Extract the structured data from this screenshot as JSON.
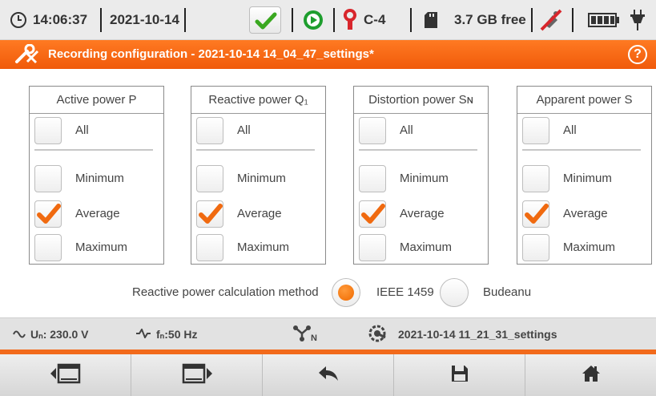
{
  "status_bar": {
    "time": "14:06:37",
    "date": "2021-10-14",
    "clamp_label": "C-4",
    "storage_free": "3.7 GB free",
    "icons": [
      "clock-icon",
      "checkmark-icon",
      "record-play-icon",
      "clamp-icon",
      "sd-card-icon",
      "no-gps-icon",
      "battery-icon",
      "power-plug-icon"
    ],
    "colors": {
      "check_green": "#3aa820",
      "play_green": "#1e9e2e",
      "clamp_red": "#d8262c",
      "bar_bg": "#ebebeb"
    }
  },
  "title_bar": {
    "title": "Recording configuration - 2021-10-14 14_04_47_settings*",
    "help_label": "?",
    "color": "#f26a1b"
  },
  "panels": [
    {
      "title": "Active power P",
      "all_label": "All",
      "options": [
        {
          "label": "Minimum",
          "checked": false
        },
        {
          "label": "Average",
          "checked": true
        },
        {
          "label": "Maximum",
          "checked": false
        }
      ]
    },
    {
      "title": "Reactive power Q₁",
      "all_label": "All",
      "options": [
        {
          "label": "Minimum",
          "checked": false
        },
        {
          "label": "Average",
          "checked": true
        },
        {
          "label": "Maximum",
          "checked": false
        }
      ]
    },
    {
      "title": "Distortion power Sɴ",
      "all_label": "All",
      "options": [
        {
          "label": "Minimum",
          "checked": false
        },
        {
          "label": "Average",
          "checked": true
        },
        {
          "label": "Maximum",
          "checked": false
        }
      ]
    },
    {
      "title": "Apparent power S",
      "all_label": "All",
      "options": [
        {
          "label": "Minimum",
          "checked": false
        },
        {
          "label": "Average",
          "checked": true
        },
        {
          "label": "Maximum",
          "checked": false
        }
      ]
    }
  ],
  "method": {
    "label": "Reactive power calculation method",
    "options": [
      {
        "label": "IEEE 1459",
        "selected": true
      },
      {
        "label": "Budeanu",
        "selected": false
      }
    ]
  },
  "info_bar": {
    "voltage": "Uₙ: 230.0 V",
    "frequency": "fₙ:50 Hz",
    "network_sub": "N",
    "settings_file": "2021-10-14 11_21_31_settings"
  },
  "bottom_bar": {
    "buttons": [
      "previous-screen-icon",
      "next-screen-icon",
      "back-icon",
      "save-icon",
      "home-icon"
    ]
  }
}
